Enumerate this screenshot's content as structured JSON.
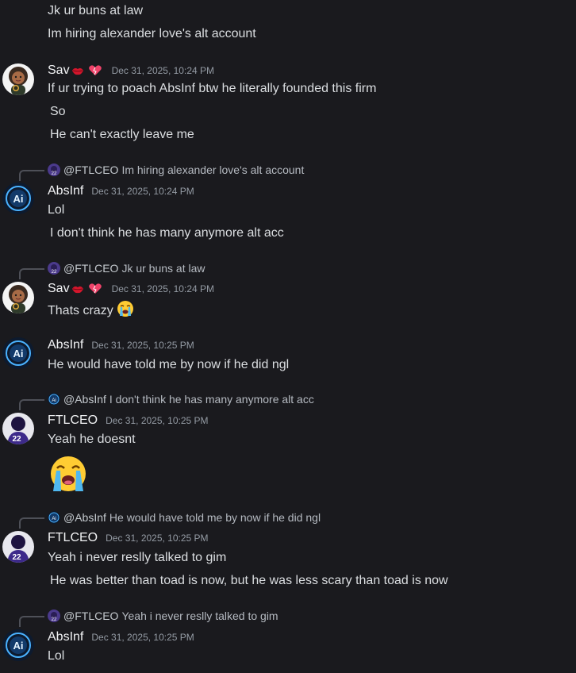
{
  "messages": {
    "m0": {
      "lines": [
        "Jk ur buns at law",
        "Im hiring alexander love's alt account"
      ]
    },
    "m1": {
      "author": "Sav",
      "timestamp": "Dec 31, 2025, 10:24 PM",
      "lines": [
        "If ur trying to poach AbsInf btw he literally founded this firm",
        "So",
        "He can't exactly leave me"
      ]
    },
    "m2": {
      "reply": {
        "name": "@FTLCEO",
        "text": "Im hiring alexander love's alt account"
      },
      "author": "AbsInf",
      "timestamp": "Dec 31, 2025, 10:24 PM",
      "lines": [
        "Lol",
        "I don't think he has many anymore alt acc"
      ]
    },
    "m3": {
      "reply": {
        "name": "@FTLCEO",
        "text": "Jk ur buns at law"
      },
      "author": "Sav",
      "timestamp": "Dec 31, 2025, 10:24 PM",
      "lines": [
        "Thats crazy"
      ]
    },
    "m4": {
      "author": "AbsInf",
      "timestamp": "Dec 31, 2025, 10:25 PM",
      "lines": [
        "He would have told me by now if he did ngl"
      ]
    },
    "m5": {
      "reply": {
        "name": "@AbsInf",
        "text": "I don't think he has many anymore alt acc"
      },
      "author": "FTLCEO",
      "timestamp": "Dec 31, 2025, 10:25 PM",
      "lines": [
        "Yeah he doesnt"
      ]
    },
    "m6": {
      "reply": {
        "name": "@AbsInf",
        "text": "He would have told me by now if he did ngl"
      },
      "author": "FTLCEO",
      "timestamp": "Dec 31, 2025, 10:25 PM",
      "lines": [
        "Yeah i never reslly talked to gim",
        "He was better than toad is now, but he was less scary than toad is now"
      ]
    },
    "m7": {
      "reply": {
        "name": "@FTLCEO",
        "text": "Yeah i never reslly talked to gim"
      },
      "author": "AbsInf",
      "timestamp": "Dec 31, 2025, 10:25 PM",
      "lines": [
        "Lol"
      ]
    }
  },
  "icons": {
    "lips": "lips-emoji-icon",
    "heart": "heart-emoji-icon",
    "crying": "loudly-crying-emoji-icon"
  },
  "colors": {
    "background": "#1a1a1e",
    "text": "#dbdee1",
    "username": "#f2f3f5",
    "timestamp": "#949ba4",
    "reply_spine": "#4e5058"
  }
}
